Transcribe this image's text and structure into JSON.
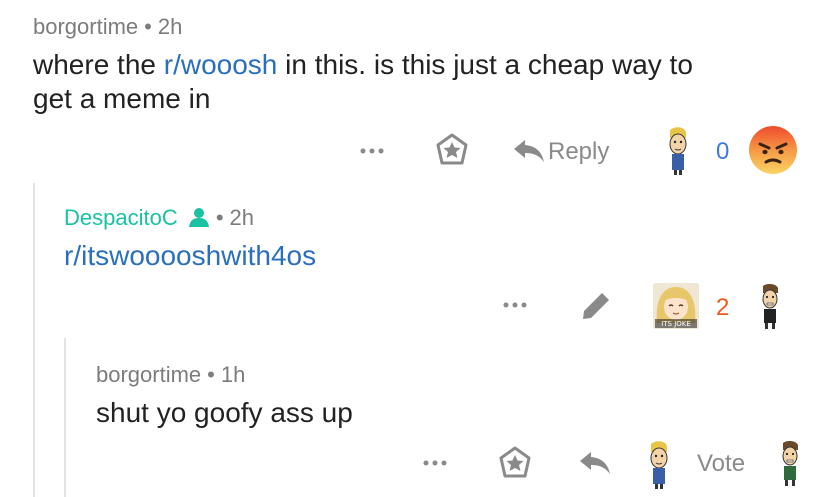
{
  "thread": {
    "comments": [
      {
        "author": "borgortime",
        "time": "2h",
        "text_before_link": "where the ",
        "link_text": "r/wooosh",
        "text_after_link": " in this. is this just a cheap way to",
        "text_line2": "get a meme in",
        "actions": {
          "reply_label": "Reply",
          "score": "0"
        }
      },
      {
        "author": "DespacitoC",
        "time": "2h",
        "link_text": "r/itswooooshwith4os",
        "actions": {
          "score": "2",
          "flair_text": "ITS JOKE"
        }
      },
      {
        "author": "borgortime",
        "time": "1h",
        "text": "shut yo goofy ass up",
        "actions": {
          "vote_label": "Vote"
        }
      }
    ]
  },
  "colors": {
    "link": "#2a6fbf",
    "author_op": "#19c2a3",
    "score_blue": "#3c7ae0",
    "score_orange": "#ef5a1f",
    "meta_gray": "#7c7c7c"
  }
}
